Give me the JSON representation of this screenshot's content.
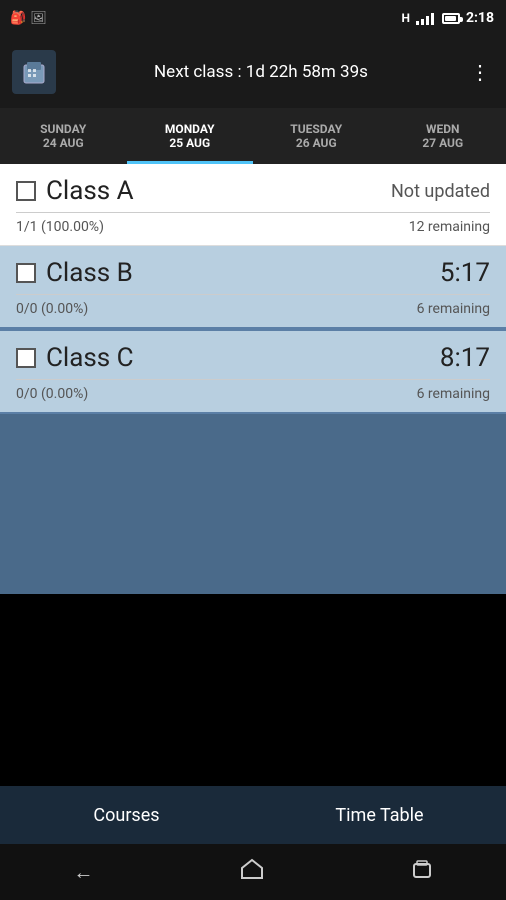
{
  "statusBar": {
    "time": "2:18",
    "signal": "H",
    "wifiBars": 4
  },
  "topBar": {
    "title": "Next class : 1d 22h 58m 39s",
    "moreLabel": "⋮"
  },
  "dayTabs": [
    {
      "day": "SUNDAY",
      "date": "24 AUG",
      "active": false
    },
    {
      "day": "MONDAY",
      "date": "25 AUG",
      "active": true
    },
    {
      "day": "TUESDAY",
      "date": "26 AUG",
      "active": false
    },
    {
      "day": "WEDN",
      "date": "27 AUG",
      "active": false
    }
  ],
  "classes": [
    {
      "name": "Class A",
      "status": "Not updated",
      "time": "",
      "progress": "1/1 (100.00%)",
      "remaining": "12 remaining",
      "style": "white"
    },
    {
      "name": "Class B",
      "status": "",
      "time": "5:17",
      "progress": "0/0 (0.00%)",
      "remaining": "6 remaining",
      "style": "blue"
    },
    {
      "name": "Class C",
      "status": "",
      "time": "8:17",
      "progress": "0/0 (0.00%)",
      "remaining": "6 remaining",
      "style": "blue"
    }
  ],
  "bottomNav": [
    {
      "label": "Courses"
    },
    {
      "label": "Time Table"
    }
  ],
  "systemNav": {
    "back": "←",
    "home": "⌂",
    "recent": "▭"
  }
}
